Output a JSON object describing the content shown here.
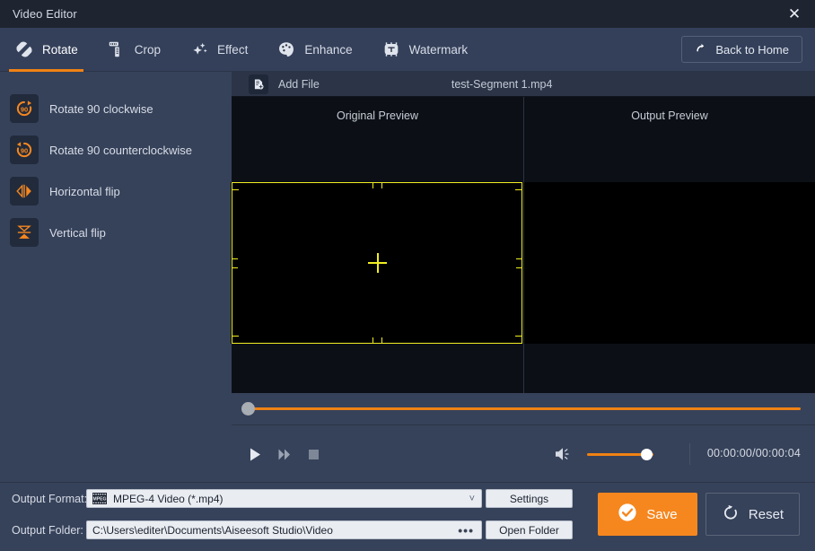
{
  "window": {
    "title": "Video Editor",
    "close_icon": "close-icon"
  },
  "toolbar": {
    "tabs": [
      {
        "label": "Rotate",
        "icon": "rotate-icon",
        "active": true
      },
      {
        "label": "Crop",
        "icon": "crop-icon",
        "active": false
      },
      {
        "label": "Effect",
        "icon": "effect-icon",
        "active": false
      },
      {
        "label": "Enhance",
        "icon": "enhance-icon",
        "active": false
      },
      {
        "label": "Watermark",
        "icon": "watermark-icon",
        "active": false
      }
    ],
    "back_home_label": "Back to Home",
    "back_home_icon": "return-arrow-icon",
    "accent_color": "#f08214"
  },
  "sidebar": {
    "items": [
      {
        "label": "Rotate 90 clockwise",
        "icon": "rotate-cw-90-icon"
      },
      {
        "label": "Rotate 90 counterclockwise",
        "icon": "rotate-ccw-90-icon"
      },
      {
        "label": "Horizontal flip",
        "icon": "horizontal-flip-icon"
      },
      {
        "label": "Vertical flip",
        "icon": "vertical-flip-icon"
      }
    ]
  },
  "preview": {
    "add_file_label": "Add File",
    "add_file_icon": "add-file-icon",
    "file_name": "test-Segment 1.mp4",
    "original_title": "Original Preview",
    "output_title": "Output Preview",
    "crop_overlay_color": "#f2ee21"
  },
  "player": {
    "seek_position_percent": 0,
    "play_icon": "play-icon",
    "fast_forward_icon": "fast-forward-icon",
    "stop_icon": "stop-icon",
    "volume_icon": "volume-icon",
    "volume_percent": 100,
    "time_code": "00:00:00/00:00:04"
  },
  "bottom": {
    "output_format_label": "Output Format:",
    "output_format_value": "MPEG-4 Video (*.mp4)",
    "output_format_icon": "mpeg4-icon",
    "format_dropdown_icon": "chevron-down-icon",
    "output_folder_label": "Output Folder:",
    "output_folder_value": "C:\\Users\\editer\\Documents\\Aiseesoft Studio\\Video",
    "browse_label": "•••",
    "settings_label": "Settings",
    "open_folder_label": "Open Folder",
    "save_label": "Save",
    "save_icon": "check-circle-icon",
    "save_color": "#f6871f",
    "reset_label": "Reset",
    "reset_icon": "reset-arrow-icon"
  }
}
